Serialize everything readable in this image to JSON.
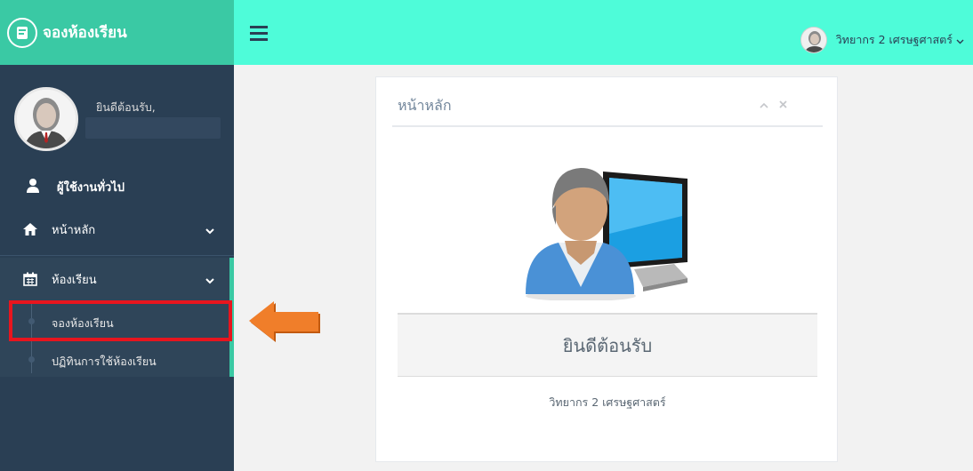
{
  "sidebar": {
    "brand": "จองห้องเรียน",
    "welcome": "ยินดีต้อนรับ,",
    "section": "ผู้ใช้งานทั่วไป",
    "menu": {
      "home": "หน้าหลัก",
      "classroom": "ห้องเรียน"
    },
    "submenu": {
      "book": "จองห้องเรียน",
      "calendar": "ปฏิทินการใช้ห้องเรียน"
    },
    "icons": [
      "book-icon",
      "user-icon",
      "home-icon",
      "calendar-icon",
      "chevron-down-icon"
    ]
  },
  "topbar": {
    "user_name": "วิทยากร 2 เศรษฐศาสตร์"
  },
  "panel": {
    "title": "หน้าหลัก",
    "welcome": "ยินดีต้อนรับ",
    "user_name": "วิทยากร 2 เศรษฐศาสตร์"
  },
  "colors": {
    "sidebar": "#2a3f54",
    "brand": "#3ac9a4",
    "topbar": "#4efcd9",
    "highlight": "#e8151e",
    "arrow": "#f07e2a"
  }
}
